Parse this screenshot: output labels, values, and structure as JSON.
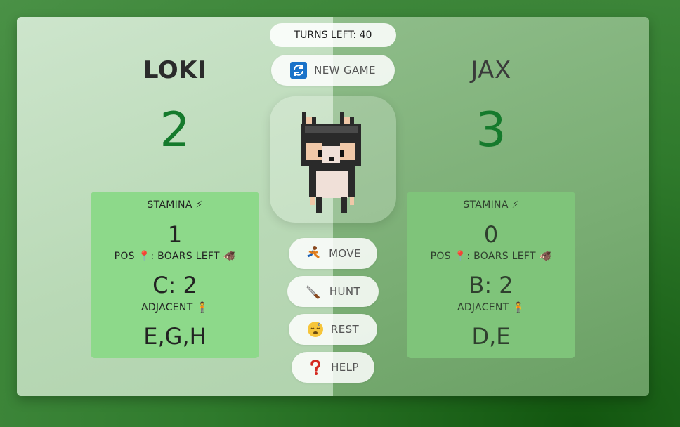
{
  "game": {
    "turns_left": "TURNS LEFT: 40",
    "new_game_label": "NEW GAME"
  },
  "players": [
    {
      "name": "LOKI",
      "score": "2",
      "stamina_label": "STAMINA ⚡",
      "stamina_value": "1",
      "pos_label": "POS 📍: BOARS LEFT 🐗",
      "pos_value": "C: 2",
      "adjacent_label": "ADJACENT 🧍",
      "adjacent_value": "E,G,H"
    },
    {
      "name": "JAX",
      "score": "3",
      "stamina_label": "STAMINA ⚡",
      "stamina_value": "0",
      "pos_label": "POS 📍: BOARS LEFT 🐗",
      "pos_value": "B: 2",
      "adjacent_label": "ADJACENT 🧍",
      "adjacent_value": "D,E"
    }
  ],
  "actions": {
    "move": "MOVE",
    "hunt": "HUNT",
    "rest": "REST",
    "help": "HELP"
  },
  "icons": {
    "refresh": "refresh-icon",
    "move": "running-person-icon",
    "hunt": "knife-icon",
    "rest": "sleeping-face-icon",
    "help": "question-mark-icon",
    "portrait": "pixel-cat-icon"
  },
  "colors": {
    "score": "#157a2c",
    "left_panel": "#8dd98a",
    "right_panel": "#7fc47a"
  }
}
